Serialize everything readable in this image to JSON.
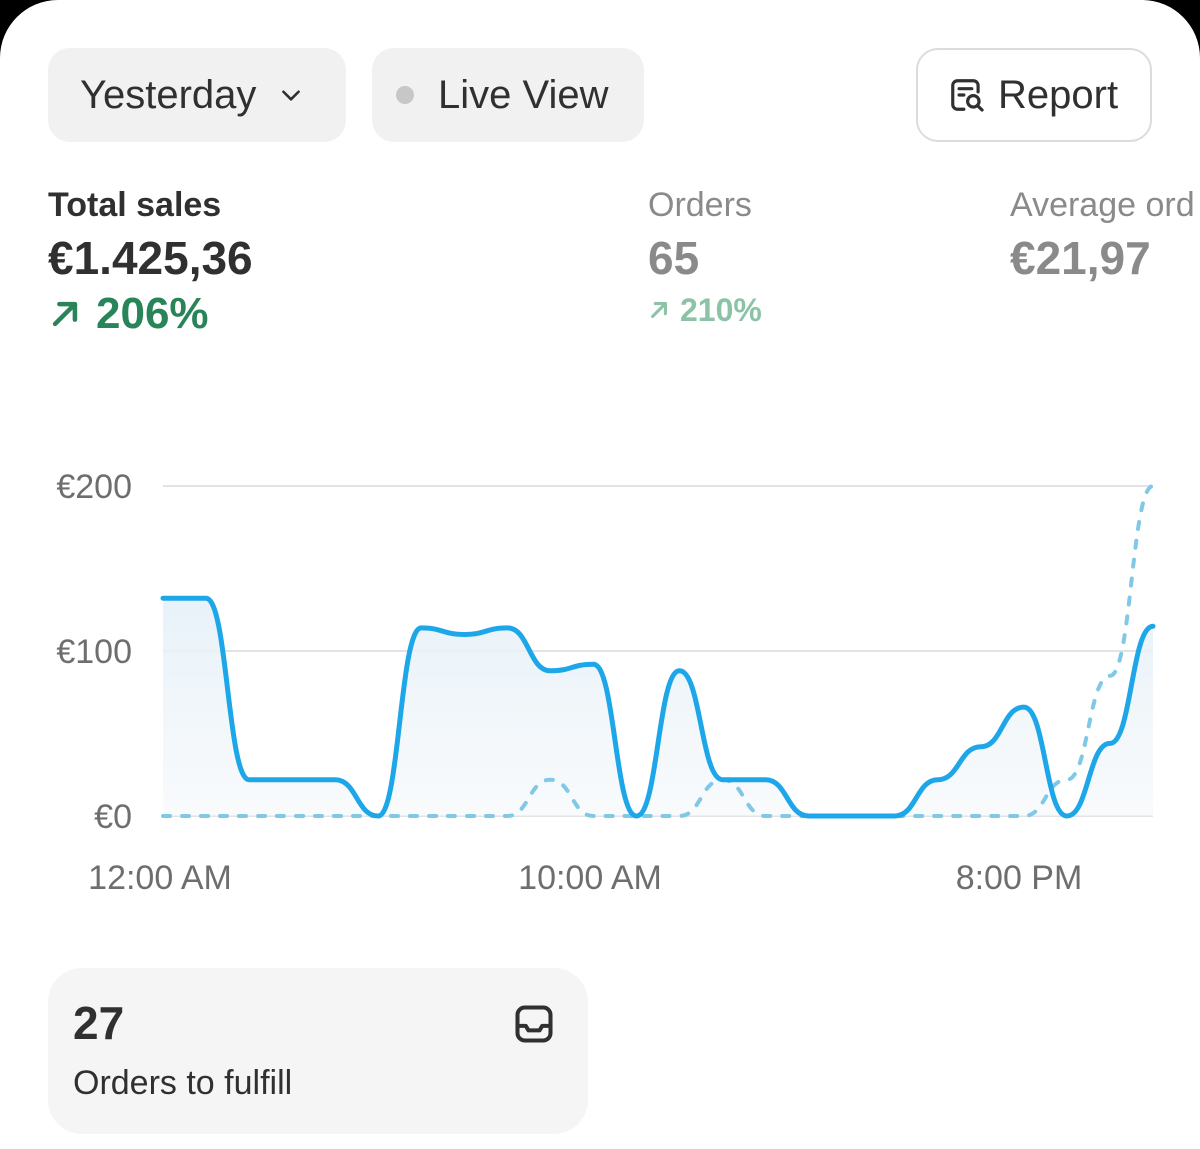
{
  "filters": {
    "date_label": "Yesterday",
    "live_label": "Live View",
    "report_label": "Report"
  },
  "metrics": [
    {
      "label": "Total sales",
      "value": "€1.425,36",
      "change": "206%"
    },
    {
      "label": "Orders",
      "value": "65",
      "change": "210%"
    },
    {
      "label": "Average ord",
      "value": "€21,97"
    }
  ],
  "fulfill": {
    "count": "27",
    "label": "Orders to fulfill"
  },
  "icons": {
    "date_chevron": "chevron-down-icon",
    "live": "status-dot-icon",
    "report": "report-search-icon",
    "change_up": "arrow-up-right-icon",
    "fulfill": "inbox-icon"
  },
  "colors": {
    "current_series": "#1ea7e8",
    "comparison_series": "#7fc8e6",
    "positive_change": "#29845a",
    "positive_change_muted": "#8cc3a6"
  },
  "chart_data": {
    "type": "line",
    "y_ticks": [
      "€200",
      "€100",
      "€0"
    ],
    "ylim": [
      0,
      200
    ],
    "x_tick_labels": [
      "12:00 AM",
      "10:00 AM",
      "8:00 PM"
    ],
    "x": [
      0,
      1,
      2,
      3,
      4,
      5,
      6,
      7,
      8,
      9,
      10,
      11,
      12,
      13,
      14,
      15,
      16,
      17,
      18,
      19,
      20,
      21,
      22,
      23
    ],
    "grid": true,
    "legend": "none",
    "series": [
      {
        "style": "solid",
        "values": [
          132,
          132,
          22,
          22,
          22,
          0,
          114,
          110,
          114,
          88,
          92,
          0,
          88,
          22,
          22,
          0,
          0,
          0,
          22,
          42,
          66,
          0,
          44,
          115
        ]
      },
      {
        "style": "dashed",
        "values": [
          0,
          0,
          0,
          0,
          0,
          0,
          0,
          0,
          0,
          22,
          0,
          0,
          0,
          22,
          0,
          0,
          0,
          0,
          0,
          0,
          0,
          22,
          85,
          200
        ]
      }
    ]
  }
}
